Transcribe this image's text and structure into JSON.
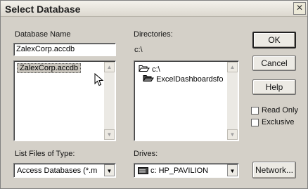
{
  "window": {
    "title": "Select Database"
  },
  "database_name": {
    "label": "Database Name",
    "value": "ZalexCorp.accdb",
    "files": [
      "ZalexCorp.accdb"
    ]
  },
  "directories": {
    "label": "Directories:",
    "current_path": "c:\\",
    "items": [
      "c:\\",
      "ExcelDashboardsfo"
    ]
  },
  "file_type": {
    "label": "List Files of Type:",
    "value": "Access Databases (*.m"
  },
  "drives": {
    "label": "Drives:",
    "value": "c: HP_PAVILION"
  },
  "buttons": {
    "ok": "OK",
    "cancel": "Cancel",
    "help": "Help",
    "network": "Network..."
  },
  "options": {
    "read_only": {
      "label": "Read Only",
      "checked": false
    },
    "exclusive": {
      "label": "Exclusive",
      "checked": false
    }
  }
}
